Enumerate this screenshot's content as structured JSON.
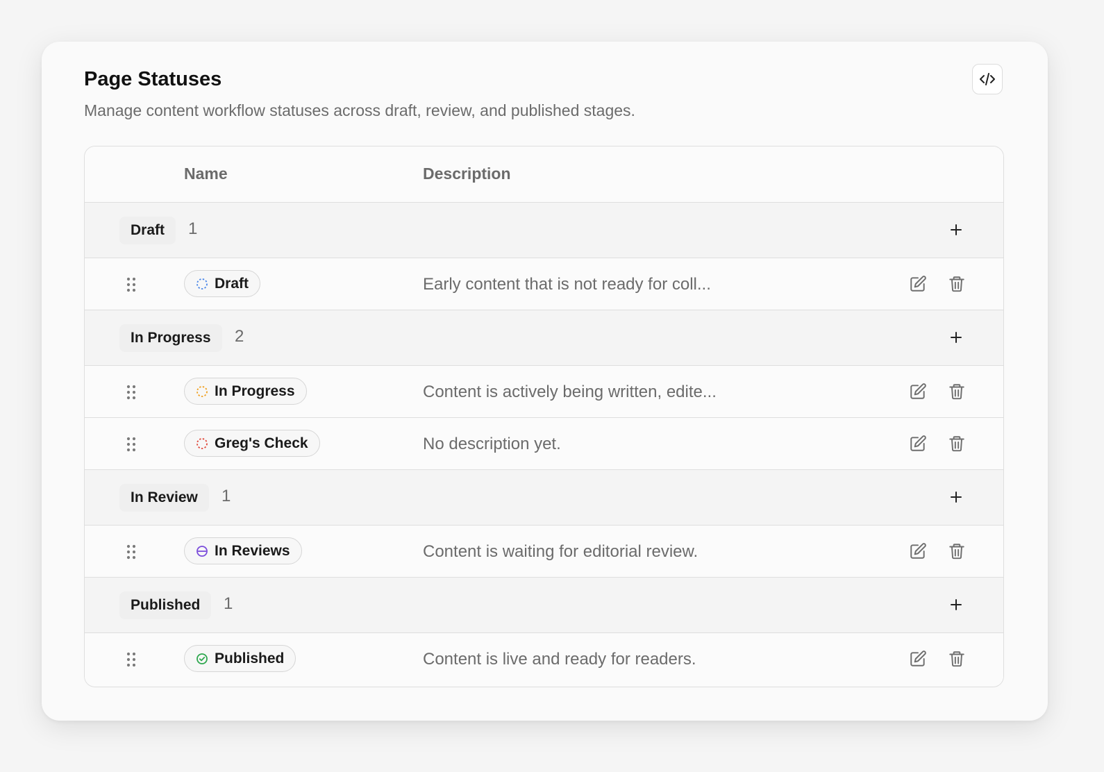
{
  "header": {
    "title": "Page Statuses",
    "subtitle": "Manage content workflow statuses across draft, review, and published stages."
  },
  "table": {
    "columns": {
      "name": "Name",
      "description": "Description"
    }
  },
  "groups": [
    {
      "label": "Draft",
      "count": "1",
      "statuses": [
        {
          "name": "Draft",
          "description": "Early content that is not ready for coll...",
          "icon": "dashed-circle-icon",
          "color": "#4a86e8"
        }
      ]
    },
    {
      "label": "In Progress",
      "count": "2",
      "statuses": [
        {
          "name": "In Progress",
          "description": "Content is actively being written, edite...",
          "icon": "dashed-circle-icon",
          "color": "#f0a020"
        },
        {
          "name": "Greg's Check",
          "description": "No description yet.",
          "icon": "dashed-circle-icon",
          "color": "#e0483a"
        }
      ]
    },
    {
      "label": "In Review",
      "count": "1",
      "statuses": [
        {
          "name": "In Reviews",
          "description": "Content is waiting for editorial review.",
          "icon": "circle-minus-icon",
          "color": "#7b4ddb"
        }
      ]
    },
    {
      "label": "Published",
      "count": "1",
      "statuses": [
        {
          "name": "Published",
          "description": "Content is live and ready for readers.",
          "icon": "circle-check-icon",
          "color": "#2fa84f"
        }
      ]
    }
  ]
}
